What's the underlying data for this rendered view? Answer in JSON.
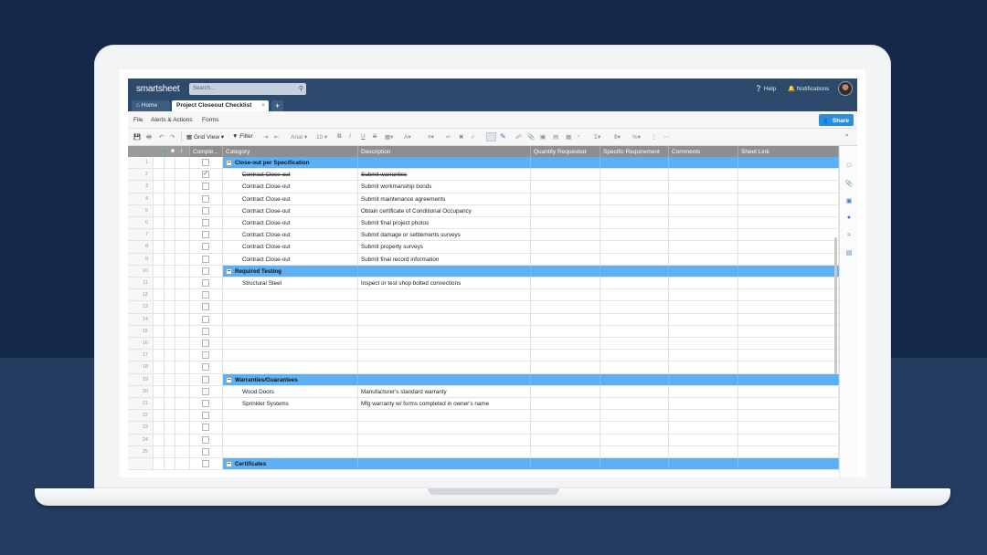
{
  "header": {
    "logo": "smartsheet",
    "search_placeholder": "Search...",
    "help_label": "Help",
    "notifications_label": "Notifications"
  },
  "tabs": {
    "home_label": "Home",
    "sheet_label": "Project Closeout Checklist",
    "close_glyph": "×",
    "add_glyph": "+"
  },
  "menu": {
    "file": "File",
    "alerts": "Alerts & Actions",
    "forms": "Forms",
    "share": "Share"
  },
  "toolbar": {
    "grid_view": "Grid View",
    "filter": "Filter",
    "font": "Arial",
    "font_size": "10",
    "bold": "B",
    "italic": "I",
    "underline": "U",
    "strike": "S"
  },
  "columns": {
    "complete": "Comple...",
    "category": "Category",
    "description": "Description",
    "quantity": "Quantity Requested",
    "specific": "Specific Requirement",
    "comments": "Comments",
    "sheet_link": "Sheet Link"
  },
  "rows": [
    {
      "num": "1",
      "type": "parent",
      "category": "Close-out per Specification",
      "description": "",
      "checked": false
    },
    {
      "num": "2",
      "type": "child",
      "category": "Contract Close-out",
      "description": "Submit warranties",
      "checked": true
    },
    {
      "num": "3",
      "type": "child",
      "category": "Contract Close-out",
      "description": "Submit workmanship bonds",
      "checked": false
    },
    {
      "num": "4",
      "type": "child",
      "category": "Contract Close-out",
      "description": "Submit maintenance agreements",
      "checked": false
    },
    {
      "num": "5",
      "type": "child",
      "category": "Contract Close-out",
      "description": "Obtain certificate of Conditional Occupancy",
      "checked": false
    },
    {
      "num": "6",
      "type": "child",
      "category": "Contract Close-out",
      "description": "Submit final project photos",
      "checked": false
    },
    {
      "num": "7",
      "type": "child",
      "category": "Contract Close-out",
      "description": "Submit damage or settlements surveys",
      "checked": false
    },
    {
      "num": "8",
      "type": "child",
      "category": "Contract Close-out",
      "description": "Submit property surveys",
      "checked": false
    },
    {
      "num": "9",
      "type": "child",
      "category": "Contract Close-out",
      "description": "Submit final record information",
      "checked": false
    },
    {
      "num": "10",
      "type": "parent",
      "category": "Required Testing",
      "description": "",
      "checked": false
    },
    {
      "num": "11",
      "type": "child",
      "category": "Structural Steel",
      "description": "Inspect or test shop bolted connections",
      "checked": false
    },
    {
      "num": "12",
      "type": "empty"
    },
    {
      "num": "13",
      "type": "empty"
    },
    {
      "num": "14",
      "type": "empty"
    },
    {
      "num": "15",
      "type": "empty"
    },
    {
      "num": "16",
      "type": "empty"
    },
    {
      "num": "17",
      "type": "empty"
    },
    {
      "num": "18",
      "type": "empty"
    },
    {
      "num": "19",
      "type": "parent",
      "category": "Warranties/Guarantees",
      "description": "",
      "checked": false
    },
    {
      "num": "20",
      "type": "child",
      "category": "Wood Doors",
      "description": "Manufacturer's standard warranty",
      "checked": false
    },
    {
      "num": "21",
      "type": "child",
      "category": "Sprinkler Systems",
      "description": "Mfg warranty w/ forms completed in owner's name",
      "checked": false
    },
    {
      "num": "22",
      "type": "empty"
    },
    {
      "num": "23",
      "type": "empty"
    },
    {
      "num": "24",
      "type": "empty"
    },
    {
      "num": "25",
      "type": "empty"
    },
    {
      "num": "",
      "type": "parent",
      "category": "Certificates",
      "description": "",
      "checked": false
    }
  ],
  "colors": {
    "header_bg": "#2d4a6d",
    "parent_row": "#5eb0f5",
    "share_button": "#2a8fd8"
  }
}
